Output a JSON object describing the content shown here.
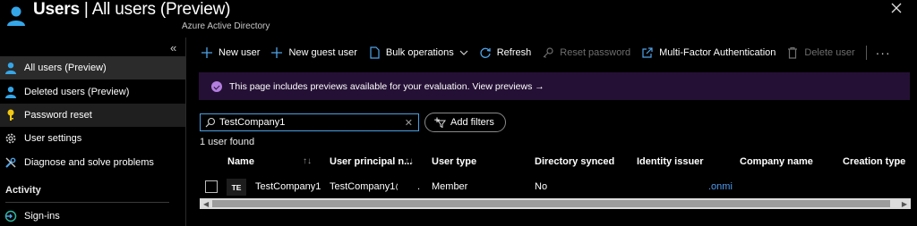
{
  "header": {
    "title_main": "Users",
    "title_sep": " | ",
    "title_rest": "All users (Preview)",
    "subtitle": "Azure Active Directory"
  },
  "sidebar": {
    "collapse": "«",
    "items": [
      {
        "label": "All users (Preview)",
        "icon": "user-icon"
      },
      {
        "label": "Deleted users (Preview)",
        "icon": "user-icon"
      },
      {
        "label": "Password reset",
        "icon": "key-icon"
      },
      {
        "label": "User settings",
        "icon": "gear-icon"
      },
      {
        "label": "Diagnose and solve problems",
        "icon": "wrench-icon"
      }
    ],
    "section": "Activity",
    "signins": "Sign-ins"
  },
  "toolbar": {
    "new_user": "New user",
    "new_guest_user": "New guest user",
    "bulk_operations": "Bulk operations",
    "refresh": "Refresh",
    "reset_password": "Reset password",
    "mfa": "Multi-Factor Authentication",
    "delete_user": "Delete user",
    "more": "···"
  },
  "banner": {
    "text": "This page includes previews available for your evaluation. View previews →"
  },
  "search": {
    "value": "TestCompany1",
    "clear": "✕"
  },
  "filters": {
    "add_filters": "Add filters"
  },
  "results": {
    "count_text": "1 user found"
  },
  "table": {
    "headers": [
      "Name",
      "User principal n...",
      "User type",
      "Directory synced",
      "Identity issuer",
      "Company name",
      "Creation type"
    ],
    "rows": [
      {
        "initials": "TE",
        "name": "TestCompany1",
        "upn": "TestCompany1@",
        "upn_tail": ".",
        "user_type": "Member",
        "directory_synced": "No",
        "identity_issuer": ".onmi"
      }
    ]
  },
  "colors": {
    "accent": "#4f9bef",
    "banner_bg": "#251035",
    "banner_icon": "#b47ee0"
  }
}
